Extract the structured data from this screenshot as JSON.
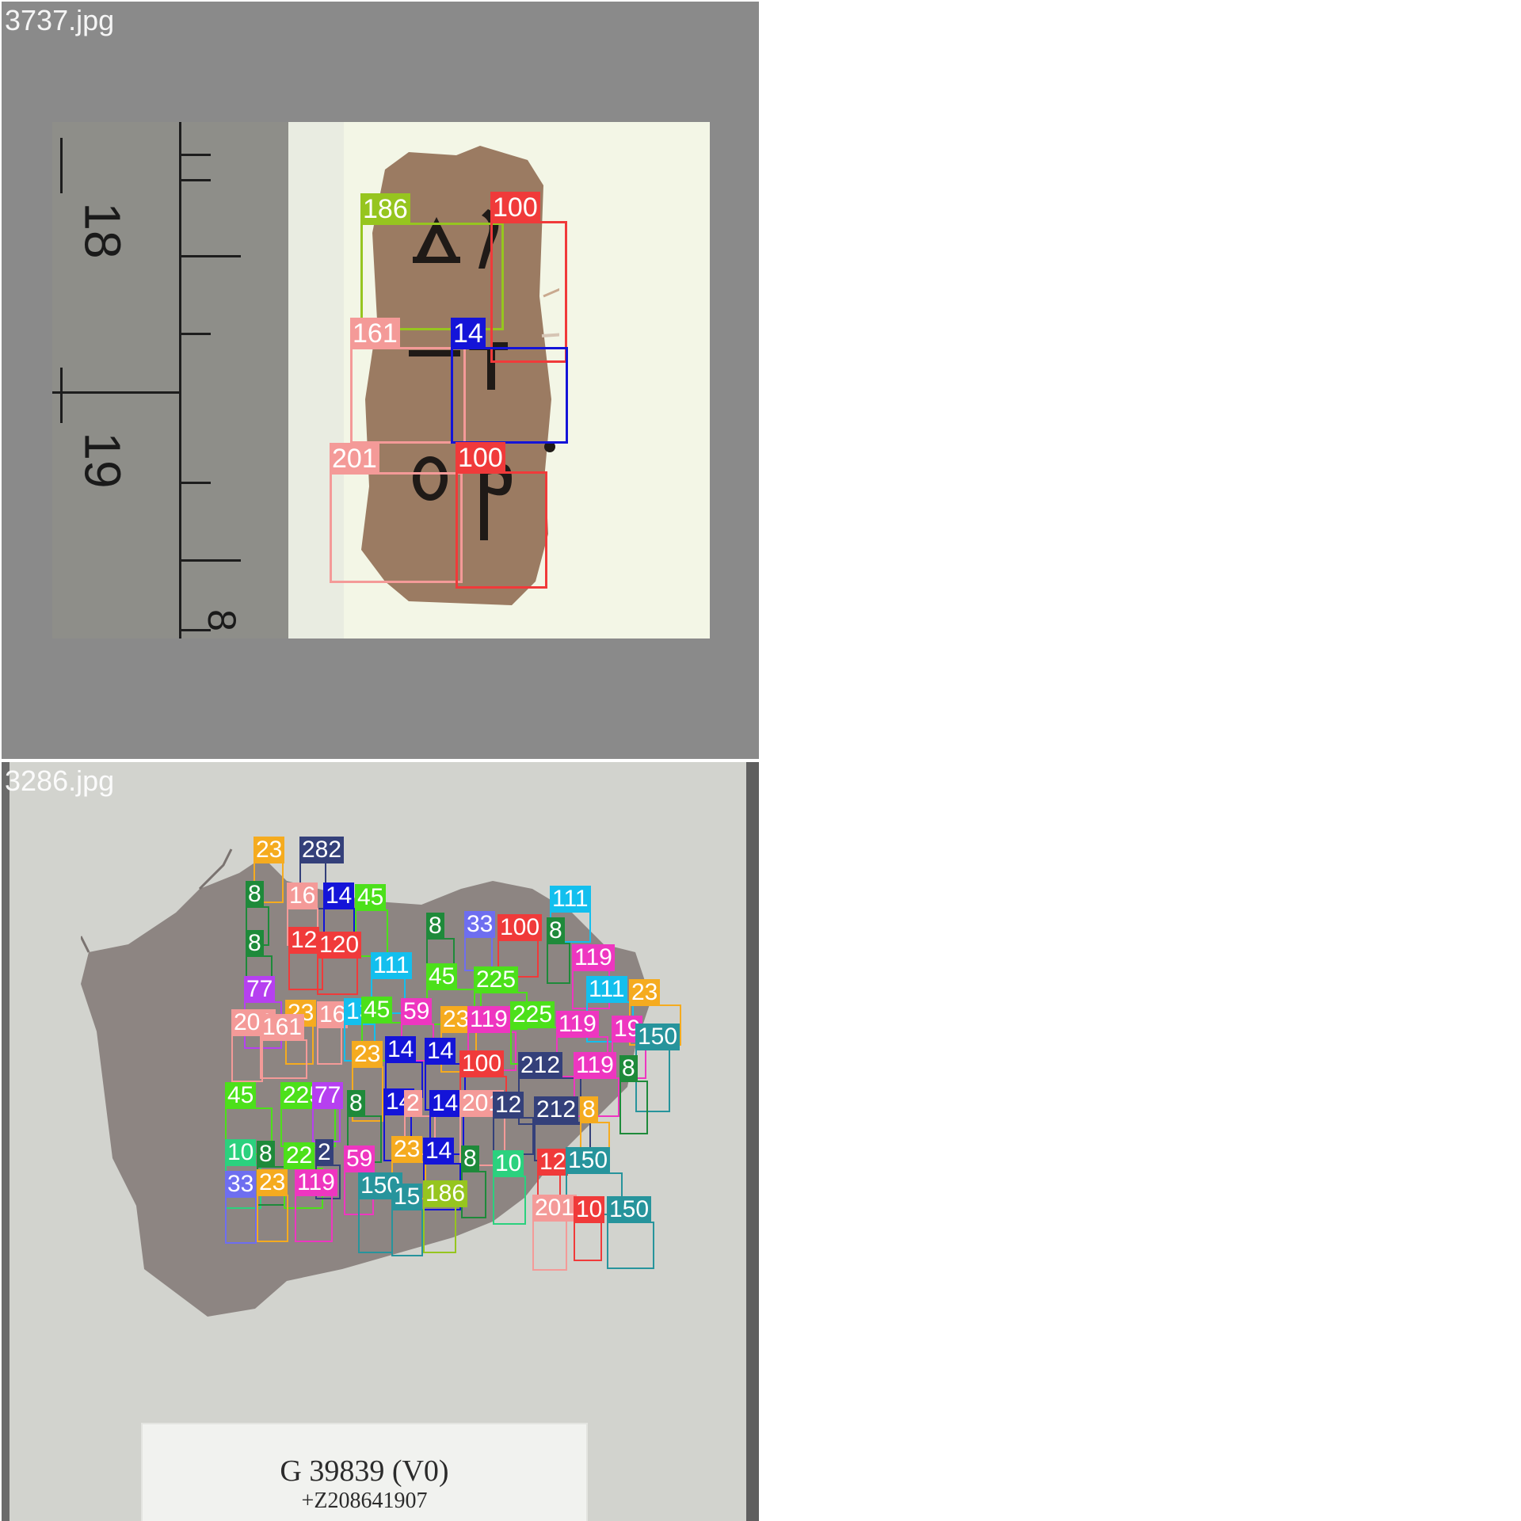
{
  "panels": [
    {
      "filename": "3737.jpg",
      "ruler_numbers": [
        "18",
        "19",
        "8"
      ],
      "colors": {
        "background": "#8a8a8a",
        "papyrus": "#9b7b62",
        "ink": "#1f1a17"
      },
      "boxes": [
        {
          "label": "186",
          "color": "#96c51f"
        },
        {
          "label": "100",
          "color": "#f03a3a"
        },
        {
          "label": "161",
          "color": "#f49a98"
        },
        {
          "label": "14",
          "color": "#1414d8"
        },
        {
          "label": "201",
          "color": "#f49a98"
        },
        {
          "label": "100",
          "color": "#f03a3a"
        }
      ]
    },
    {
      "filename": "3286.jpg",
      "catalog_card": {
        "line1": "G 39839 (V0)",
        "line2": "+Z208641907"
      },
      "colors": {
        "background": "#cfd0cc",
        "papyrus": "#8d8582"
      },
      "boxes": [
        {
          "label": "23",
          "color": "#f5ab1f"
        },
        {
          "label": "282",
          "color": "#34407a"
        },
        {
          "label": "8",
          "color": "#1e8a3a"
        },
        {
          "label": "16",
          "color": "#f49a98"
        },
        {
          "label": "14",
          "color": "#1414d8"
        },
        {
          "label": "45",
          "color": "#4ce01a"
        },
        {
          "label": "8",
          "color": "#1e8a3a"
        },
        {
          "label": "33",
          "color": "#6e6ef0"
        },
        {
          "label": "100",
          "color": "#f03a3a"
        },
        {
          "label": "111",
          "color": "#13bfee"
        },
        {
          "label": "8",
          "color": "#1e8a3a"
        },
        {
          "label": "119",
          "color": "#ee36c0"
        },
        {
          "label": "8",
          "color": "#1e8a3a"
        },
        {
          "label": "12",
          "color": "#f03a3a"
        },
        {
          "label": "120",
          "color": "#f03a3a"
        },
        {
          "label": "111",
          "color": "#13bfee"
        },
        {
          "label": "45",
          "color": "#4ce01a"
        },
        {
          "label": "225",
          "color": "#4ce01a"
        },
        {
          "label": "77",
          "color": "#b640f0"
        },
        {
          "label": "111",
          "color": "#13bfee"
        },
        {
          "label": "23",
          "color": "#f5ab1f"
        },
        {
          "label": "23",
          "color": "#f5ab1f"
        },
        {
          "label": "16",
          "color": "#f49a98"
        },
        {
          "label": "13",
          "color": "#13bfee"
        },
        {
          "label": "45",
          "color": "#4ce01a"
        },
        {
          "label": "59",
          "color": "#ee36c0"
        },
        {
          "label": "23",
          "color": "#f5ab1f"
        },
        {
          "label": "119",
          "color": "#ee36c0"
        },
        {
          "label": "225",
          "color": "#4ce01a"
        },
        {
          "label": "119",
          "color": "#ee36c0"
        },
        {
          "label": "19",
          "color": "#ee36c0"
        },
        {
          "label": "150",
          "color": "#27949c"
        },
        {
          "label": "201",
          "color": "#f49a98"
        },
        {
          "label": "161",
          "color": "#f49a98"
        },
        {
          "label": "23",
          "color": "#f5ab1f"
        },
        {
          "label": "14",
          "color": "#1414d8"
        },
        {
          "label": "14",
          "color": "#1414d8"
        },
        {
          "label": "100",
          "color": "#f03a3a"
        },
        {
          "label": "212",
          "color": "#34407a"
        },
        {
          "label": "119",
          "color": "#ee36c0"
        },
        {
          "label": "8",
          "color": "#1e8a3a"
        },
        {
          "label": "45",
          "color": "#4ce01a"
        },
        {
          "label": "225",
          "color": "#4ce01a"
        },
        {
          "label": "77",
          "color": "#b640f0"
        },
        {
          "label": "8",
          "color": "#1e8a3a"
        },
        {
          "label": "14",
          "color": "#1414d8"
        },
        {
          "label": "2",
          "color": "#f49a98"
        },
        {
          "label": "14",
          "color": "#1414d8"
        },
        {
          "label": "201",
          "color": "#f49a98"
        },
        {
          "label": "12",
          "color": "#34407a"
        },
        {
          "label": "212",
          "color": "#34407a"
        },
        {
          "label": "8",
          "color": "#f5ab1f"
        },
        {
          "label": "10",
          "color": "#2bd17e"
        },
        {
          "label": "8",
          "color": "#1e8a3a"
        },
        {
          "label": "22",
          "color": "#4ce01a"
        },
        {
          "label": "2",
          "color": "#34407a"
        },
        {
          "label": "59",
          "color": "#ee36c0"
        },
        {
          "label": "23",
          "color": "#f5ab1f"
        },
        {
          "label": "14",
          "color": "#1414d8"
        },
        {
          "label": "8",
          "color": "#1e8a3a"
        },
        {
          "label": "10",
          "color": "#2bd17e"
        },
        {
          "label": "12",
          "color": "#f03a3a"
        },
        {
          "label": "150",
          "color": "#27949c"
        },
        {
          "label": "33",
          "color": "#6e6ef0"
        },
        {
          "label": "23",
          "color": "#f5ab1f"
        },
        {
          "label": "119",
          "color": "#ee36c0"
        },
        {
          "label": "150",
          "color": "#27949c"
        },
        {
          "label": "15",
          "color": "#27949c"
        },
        {
          "label": "186",
          "color": "#96c51f"
        },
        {
          "label": "201",
          "color": "#f49a98"
        },
        {
          "label": "10",
          "color": "#f03a3a"
        },
        {
          "label": "150",
          "color": "#27949c"
        }
      ]
    }
  ]
}
